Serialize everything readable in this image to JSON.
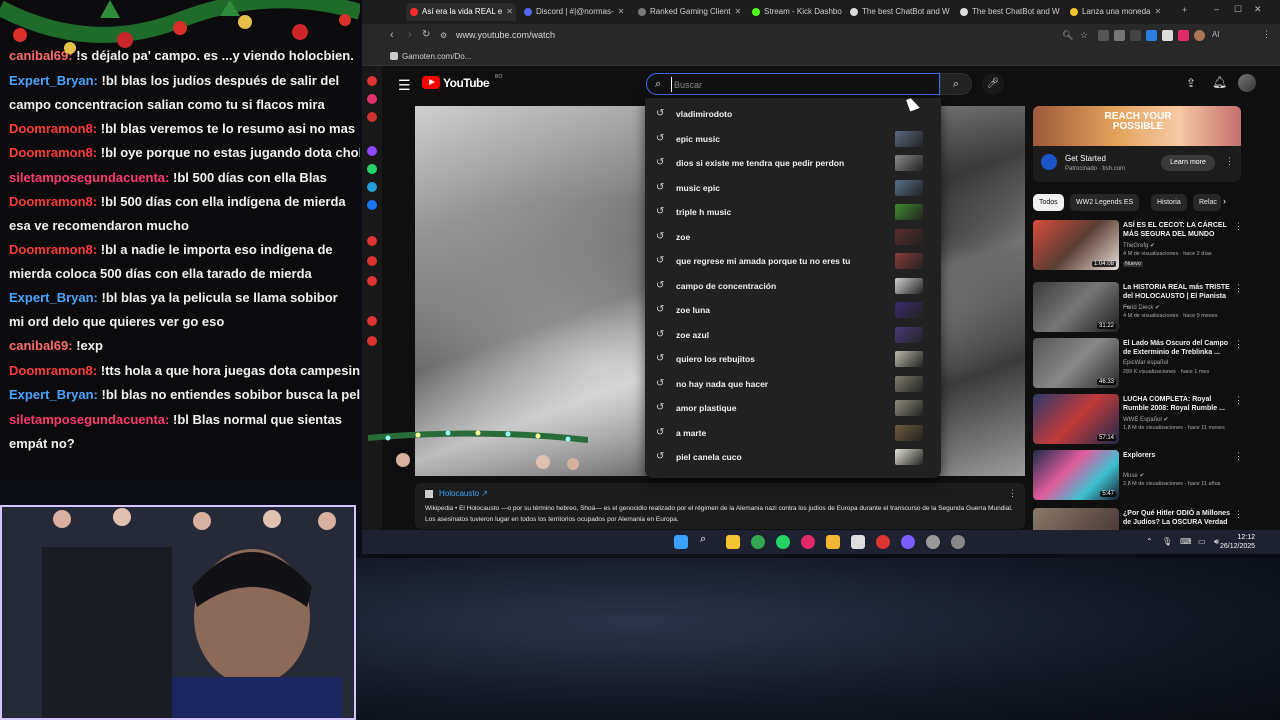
{
  "chat": {
    "messages": [
      {
        "user": "canibal69:",
        "text": " !s déjalo pa' campo. es ...y viendo holocbien.",
        "color": "#ff6b6b",
        "wrapped": false
      },
      {
        "user": "Expert_Bryan:",
        "text": " !bl blas los judíos después de salir del campo concentracion salian como tu si flacos mira tienes ..e en",
        "color": "#4aa3ff",
        "wrapped": true
      },
      {
        "user": "Doomramon8:",
        "text": " !bl blas veremos te lo resumo asi no mas",
        "color": "#ff3b3b",
        "wrapped": false
      },
      {
        "user": "Doomramon8:",
        "text": " !bl oye porque no estas jugando dota cholo de",
        "color": "#ff3b3b",
        "wrapped": false
      },
      {
        "user": "siletamposegundacuenta:",
        "text": " !bl 500 días con ella Blas",
        "color": "#ff3b6e",
        "wrapped": false
      },
      {
        "user": "Doomramon8:",
        "text": " !bl 500 días con ella indígena de mierda esa ve recomendaron mucho",
        "color": "#ff3b3b",
        "wrapped": true
      },
      {
        "user": "Doomramon8:",
        "text": " !bl a nadie le importa eso indígena de mierda coloca 500 días con ella tarado de mierda",
        "color": "#ff3b3b",
        "wrapped": true
      },
      {
        "user": "Expert_Bryan:",
        "text": " !bl blas ya la pelicula se llama sobibor mi ord delo que quieres ver go eso",
        "color": "#4aa3ff",
        "wrapped": true
      },
      {
        "user": "canibal69:",
        "text": " !exp",
        "color": "#ff6b6b",
        "wrapped": false
      },
      {
        "user": "Doomramon8:",
        "text": " !tts hola a que hora juegas dota campesino",
        "color": "#ff3b3b",
        "wrapped": false
      },
      {
        "user": "Expert_Bryan:",
        "text": " !bl blas no entiendes sobibor busca la pelicul",
        "color": "#4aa3ff",
        "wrapped": false
      },
      {
        "user": "siletamposegundacuenta:",
        "text": " !bl Blas normal que sientas empát no?",
        "color": "#ff3b6e",
        "wrapped": true
      }
    ]
  },
  "browser": {
    "tabs": [
      {
        "label": "Así era la vida REAL e",
        "color": "#ff2b2b"
      },
      {
        "label": "Discord | #|@normas-",
        "color": "#5865f2"
      },
      {
        "label": "Ranked Gaming Client",
        "color": "#7a7a7a"
      },
      {
        "label": "Stream - Kick Dashboard",
        "color": "#53fc18"
      },
      {
        "label": "The best ChatBot and W",
        "color": "#dddddd"
      },
      {
        "label": "The best ChatBot and W",
        "color": "#dddddd"
      },
      {
        "label": "Lanza una moneda",
        "color": "#f4c430"
      }
    ],
    "url": "www.youtube.com/watch",
    "bookmark": "Gamoten.com/Do...",
    "ai_label": "AI"
  },
  "youtube": {
    "wordmark": "YouTube",
    "country": "BO",
    "search_placeholder": "Buscar",
    "suggestions": [
      {
        "text": "vladimirodoto",
        "thumb": false
      },
      {
        "text": "epic music",
        "thumb": true,
        "thumb_color": "#5a6a80"
      },
      {
        "text": "dios si existe me tendra que pedir perdon",
        "thumb": true,
        "thumb_color": "#8a8a8a"
      },
      {
        "text": "music epic",
        "thumb": true,
        "thumb_color": "#58708a"
      },
      {
        "text": "triple h music",
        "thumb": true,
        "thumb_color": "#3d8c2c"
      },
      {
        "text": "zoe",
        "thumb": true,
        "thumb_color": "#5b2c2c"
      },
      {
        "text": "que regrese mi amada porque tu no eres tu",
        "thumb": true,
        "thumb_color": "#8a3a3a"
      },
      {
        "text": "campo de concentración",
        "thumb": true,
        "thumb_color": "#d0d0d0"
      },
      {
        "text": "zoe luna",
        "thumb": true,
        "thumb_color": "#3a2a6a"
      },
      {
        "text": "zoe azul",
        "thumb": true,
        "thumb_color": "#4a3a7a"
      },
      {
        "text": "quiero los rebujitos",
        "thumb": true,
        "thumb_color": "#b9b9a9"
      },
      {
        "text": "no hay nada que hacer",
        "thumb": true,
        "thumb_color": "#7d7d6d"
      },
      {
        "text": "amor plastique",
        "thumb": true,
        "thumb_color": "#8c8c7c"
      },
      {
        "text": "a marte",
        "thumb": true,
        "thumb_color": "#6d5b3c"
      },
      {
        "text": "piel canela cuco",
        "thumb": true,
        "thumb_color": "#e2e2d2"
      }
    ],
    "info": {
      "title": "Holocausto ↗",
      "text": "Wikipedia • El Holocausto —o por su término hebreo, Shoá— es el genocidio realizado por el régimen de la Alemania nazi contra los judíos de Europa durante el transcurso de la Segunda Guerra Mundial. Los asesinatos tuvieron lugar en todos los territorios ocupados por Alemania en Europa."
    },
    "ad": {
      "banner": "REACH YOUR POSSIBLE",
      "title": "Get Started",
      "sponsor": "Patrocinado · bsh.com",
      "cta": "Learn more"
    },
    "chips": [
      "Todos",
      "WW2 Legends ES",
      "Historia",
      "Relac"
    ],
    "recommendations": [
      {
        "title": "ASÍ ES EL CECOT: LA CÁRCEL MÁS SEGURA DEL MUNDO",
        "channel": "TheGrefg ✔",
        "meta": "4 M de visualizaciones · hace 2 días",
        "badge": "Nuevo",
        "duration": "1:04:08",
        "thumb": "linear-gradient(135deg,#d94c3a,#5a3d34 50%,#e8e0d8)"
      },
      {
        "title": "La HISTORIA REAL más TRISTE del HOLOCAUSTO | El Pianista ...",
        "channel": "Farid Dieck ✔",
        "meta": "4 M de visualizaciones · hace 9 meses",
        "badge": "",
        "duration": "31:22",
        "thumb": "linear-gradient(135deg,#3a3a3a,#777 50%,#1e1e1e)"
      },
      {
        "title": "El Lado Más Oscuro del Campo de Exterminio de Treblinka ...",
        "channel": "EpicWar español",
        "meta": "289 K visualizaciones · hace 1 mes",
        "badge": "",
        "duration": "46:33",
        "thumb": "linear-gradient(135deg,#555,#888 50%,#2a2a2a)"
      },
      {
        "title": "LUCHA COMPLETA: Royal Rumble 2008: Royal Rumble ...",
        "channel": "WWE Español ✔",
        "meta": "1,8 M de visualizaciones · hace 11 meses",
        "badge": "",
        "duration": "57:14",
        "thumb": "linear-gradient(135deg,#2b3a6a,#c23a3a 50%,#1e2a4a)"
      },
      {
        "title": "Explorers",
        "channel": "Muse ✔",
        "meta": "2,8 M de visualizaciones · hace 11 años",
        "badge": "",
        "duration": "5:47",
        "thumb": "linear-gradient(135deg,#1c2c4c,#e25c9c 40%,#3cc2d2 70%,#1a1a2a)"
      },
      {
        "title": "¿Por Qué Hitler ODIÓ a Millones de Judíos? La OSCURA Verdad",
        "channel": "",
        "meta": "",
        "badge": "",
        "duration": "",
        "thumb": "linear-gradient(135deg,#8a7a6a,#3a2a2a)"
      }
    ]
  },
  "taskbar": {
    "time": "12:12",
    "date": "26/12/2025"
  }
}
